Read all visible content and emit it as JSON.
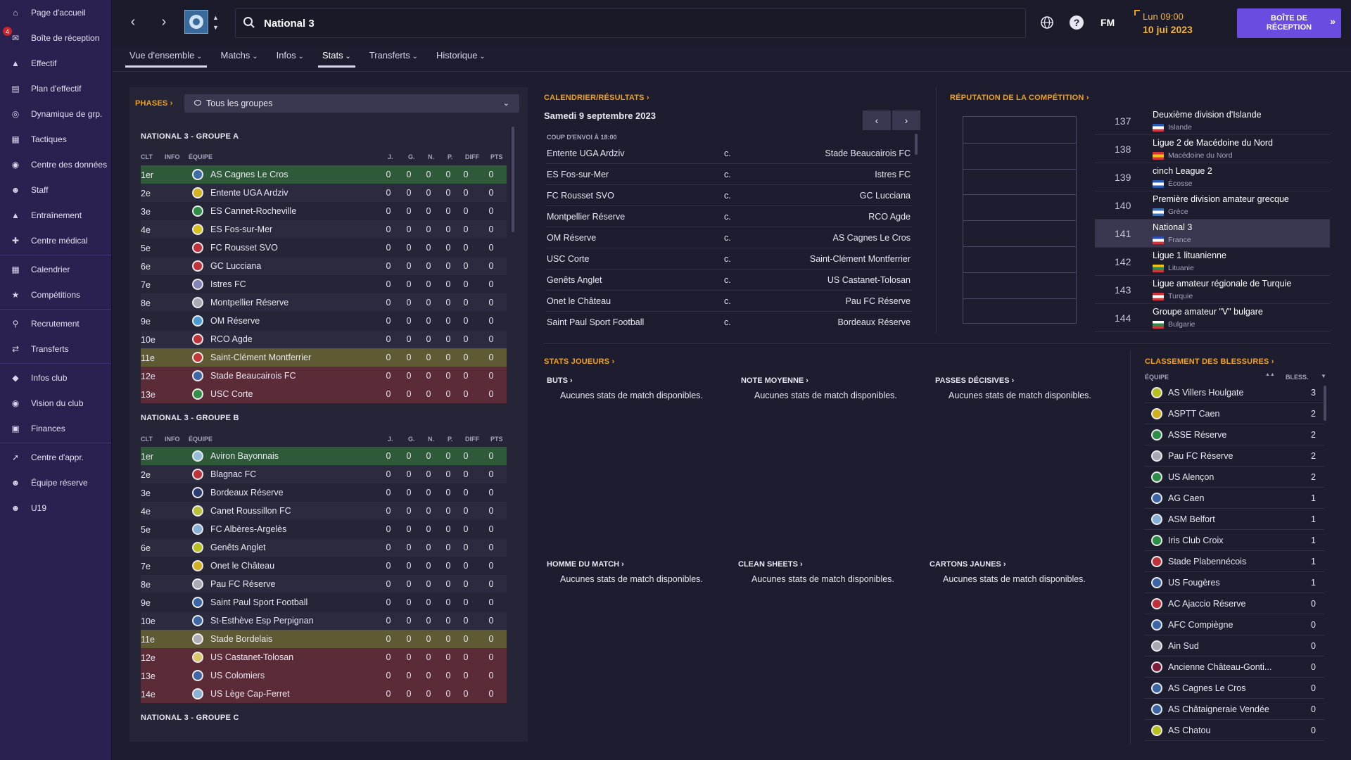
{
  "sidebar": {
    "items": [
      {
        "label": "Page d'accueil",
        "icon": "home-icon"
      },
      {
        "label": "Boîte de réception",
        "icon": "inbox-icon",
        "badge": "4"
      },
      {
        "label": "Effectif",
        "icon": "shirt-icon"
      },
      {
        "label": "Plan d'effectif",
        "icon": "clipboard-icon"
      },
      {
        "label": "Dynamique de grp.",
        "icon": "group-dynamics-icon"
      },
      {
        "label": "Tactiques",
        "icon": "tactics-board-icon"
      },
      {
        "label": "Centre des données",
        "icon": "data-hub-icon"
      },
      {
        "label": "Staff",
        "icon": "staff-icon"
      },
      {
        "label": "Entraînement",
        "icon": "training-cone-icon"
      },
      {
        "label": "Centre médical",
        "icon": "medical-kit-icon"
      },
      {
        "label": "Calendrier",
        "icon": "calendar-icon"
      },
      {
        "label": "Compétitions",
        "icon": "trophy-icon"
      },
      {
        "label": "Recrutement",
        "icon": "scout-search-icon"
      },
      {
        "label": "Transferts",
        "icon": "transfer-arrows-icon"
      },
      {
        "label": "Infos club",
        "icon": "club-shield-icon"
      },
      {
        "label": "Vision du club",
        "icon": "club-vision-icon"
      },
      {
        "label": "Finances",
        "icon": "money-icon"
      },
      {
        "label": "Centre d'appr.",
        "icon": "academy-shoe-icon"
      },
      {
        "label": "Équipe réserve",
        "icon": "reserve-team-icon"
      },
      {
        "label": "U19",
        "icon": "youth-team-icon"
      }
    ]
  },
  "topbar": {
    "search_text": "National 3",
    "date_time": "Lun 09:00",
    "date": "10 jui 2023",
    "inbox_button": "BOÎTE DE RÉCEPTION",
    "fm_label": "FM"
  },
  "tabs": [
    {
      "label": "Vue d'ensemble"
    },
    {
      "label": "Matchs"
    },
    {
      "label": "Infos"
    },
    {
      "label": "Stats"
    },
    {
      "label": "Transferts"
    },
    {
      "label": "Historique"
    }
  ],
  "phases": {
    "label": "PHASES",
    "dropdown": "Tous les groupes"
  },
  "table_headers": {
    "pos": "CLT",
    "info": "INFO",
    "team": "ÉQUIPE",
    "p": "J.",
    "w": "G.",
    "d": "N.",
    "l": "P.",
    "gd": "DIFF",
    "pts": "PTS"
  },
  "group_a": {
    "title": "NATIONAL 3 - GROUPE A",
    "rows": [
      {
        "pos": "1er",
        "team": "AS Cagnes Le Cros",
        "zone": "promo",
        "color": "#3f6fb3"
      },
      {
        "pos": "2e",
        "team": "Entente UGA Ardziv",
        "zone": "",
        "color": "#e4c21c"
      },
      {
        "pos": "3e",
        "team": "ES Cannet-Rocheville",
        "zone": "",
        "color": "#2e9a4a"
      },
      {
        "pos": "4e",
        "team": "ES Fos-sur-Mer",
        "zone": "",
        "color": "#e8d21a"
      },
      {
        "pos": "5e",
        "team": "FC Rousset SVO",
        "zone": "",
        "color": "#d0353b"
      },
      {
        "pos": "6e",
        "team": "GC Lucciana",
        "zone": "",
        "color": "#d0353b"
      },
      {
        "pos": "7e",
        "team": "Istres FC",
        "zone": "",
        "color": "#8a8fc4"
      },
      {
        "pos": "8e",
        "team": "Montpellier Réserve",
        "zone": "",
        "color": "#b8b8c4"
      },
      {
        "pos": "9e",
        "team": "OM Réserve",
        "zone": "",
        "color": "#4fa8e0"
      },
      {
        "pos": "10e",
        "team": "RCO Agde",
        "zone": "",
        "color": "#d0353b"
      },
      {
        "pos": "11e",
        "team": "Saint-Clément Montferrier",
        "zone": "play",
        "color": "#d0353b"
      },
      {
        "pos": "12e",
        "team": "Stade Beaucairois FC",
        "zone": "rel",
        "color": "#3f6fb3"
      },
      {
        "pos": "13e",
        "team": "USC Corte",
        "zone": "rel",
        "color": "#2e9a4a"
      }
    ]
  },
  "group_b": {
    "title": "NATIONAL 3 - GROUPE B",
    "rows": [
      {
        "pos": "1er",
        "team": "Aviron Bayonnais",
        "zone": "promo",
        "color": "#9ec7e8"
      },
      {
        "pos": "2e",
        "team": "Blagnac FC",
        "zone": "",
        "color": "#d0353b"
      },
      {
        "pos": "3e",
        "team": "Bordeaux Réserve",
        "zone": "",
        "color": "#2b3f7a"
      },
      {
        "pos": "4e",
        "team": "Canet Roussillon FC",
        "zone": "",
        "color": "#c8d23a"
      },
      {
        "pos": "5e",
        "team": "FC Albères-Argelès",
        "zone": "",
        "color": "#8ec0e6"
      },
      {
        "pos": "6e",
        "team": "Genêts Anglet",
        "zone": "",
        "color": "#c8d21a"
      },
      {
        "pos": "7e",
        "team": "Onet le Château",
        "zone": "",
        "color": "#e4c21c"
      },
      {
        "pos": "8e",
        "team": "Pau FC Réserve",
        "zone": "",
        "color": "#b8b8c4"
      },
      {
        "pos": "9e",
        "team": "Saint Paul Sport Football",
        "zone": "",
        "color": "#3f6fb3"
      },
      {
        "pos": "10e",
        "team": "St-Esthève Esp Perpignan",
        "zone": "",
        "color": "#3f6fb3"
      },
      {
        "pos": "11e",
        "team": "Stade Bordelais",
        "zone": "play",
        "color": "#b8b8c4"
      },
      {
        "pos": "12e",
        "team": "US Castanet-Tolosan",
        "zone": "rel",
        "color": "#e8d86a"
      },
      {
        "pos": "13e",
        "team": "US Colomiers",
        "zone": "rel",
        "color": "#3f6fb3"
      },
      {
        "pos": "14e",
        "team": "US Lège Cap-Ferret",
        "zone": "rel",
        "color": "#8ec0e6"
      }
    ]
  },
  "group_c": {
    "title": "NATIONAL 3 - GROUPE C"
  },
  "fixtures": {
    "title": "CALENDRIER/RÉSULTATS",
    "date": "Samedi 9 septembre 2023",
    "kickoff": "COUP D'ENVOI À 18:00",
    "versus": "c.",
    "rows": [
      {
        "home": "Entente UGA Ardziv",
        "away": "Stade Beaucairois FC"
      },
      {
        "home": "ES Fos-sur-Mer",
        "away": "Istres FC"
      },
      {
        "home": "FC Rousset SVO",
        "away": "GC Lucciana"
      },
      {
        "home": "Montpellier Réserve",
        "away": "RCO Agde"
      },
      {
        "home": "OM Réserve",
        "away": "AS Cagnes Le Cros"
      },
      {
        "home": "USC Corte",
        "away": "Saint-Clément Montferrier"
      },
      {
        "home": "Genêts Anglet",
        "away": "US Castanet-Tolosan"
      },
      {
        "home": "Onet le Château",
        "away": "Pau FC Réserve"
      },
      {
        "home": "Saint Paul Sport Football",
        "away": "Bordeaux Réserve"
      }
    ]
  },
  "reputation": {
    "title": "RÉPUTATION DE LA COMPÉTITION",
    "rows": [
      {
        "rank": "137",
        "name": "Deuxième division d'Islande",
        "country": "Islande",
        "flag": [
          "#2a5ab0",
          "#fff",
          "#d0353b"
        ]
      },
      {
        "rank": "138",
        "name": "Ligue 2 de Macédoine du Nord",
        "country": "Macédoine du Nord",
        "flag": [
          "#d0353b",
          "#f1c21a",
          "#d0353b"
        ]
      },
      {
        "rank": "139",
        "name": "cinch League 2",
        "country": "Écosse",
        "flag": [
          "#2a5ab0",
          "#fff",
          "#2a5ab0"
        ]
      },
      {
        "rank": "140",
        "name": "Première division amateur grecque",
        "country": "Grèce",
        "flag": [
          "#3f6fb3",
          "#fff",
          "#3f6fb3"
        ]
      },
      {
        "rank": "141",
        "name": "National 3",
        "country": "France",
        "flag": [
          "#2a4ab0",
          "#fff",
          "#d0353b"
        ],
        "selected": true
      },
      {
        "rank": "142",
        "name": "Ligue 1 lituanienne",
        "country": "Lituanie",
        "flag": [
          "#f1c21a",
          "#2e8a4a",
          "#d0353b"
        ]
      },
      {
        "rank": "143",
        "name": "Ligue amateur régionale de Turquie",
        "country": "Turquie",
        "flag": [
          "#d0353b",
          "#fff",
          "#d0353b"
        ]
      },
      {
        "rank": "144",
        "name": "Groupe amateur \"V\" bulgare",
        "country": "Bulgarie",
        "flag": [
          "#fff",
          "#2e8a4a",
          "#d0353b"
        ]
      }
    ]
  },
  "player_stats": {
    "title": "STATS JOUEURS",
    "empty_text": "Aucunes stats de match disponibles.",
    "categories": [
      {
        "label": "BUTS"
      },
      {
        "label": "NOTE MOYENNE"
      },
      {
        "label": "PASSES DÉCISIVES"
      },
      {
        "label": "HOMME DU MATCH"
      },
      {
        "label": "CLEAN SHEETS"
      },
      {
        "label": "CARTONS JAUNES"
      }
    ]
  },
  "injuries": {
    "title": "CLASSEMENT DES BLESSURES",
    "team_header": "ÉQUIPE",
    "count_header": "BLESS.",
    "rows": [
      {
        "team": "AS Villers Houlgate",
        "value": "3",
        "color": "#c8d21a"
      },
      {
        "team": "ASPTT Caen",
        "value": "2",
        "color": "#e4c21c"
      },
      {
        "team": "ASSE Réserve",
        "value": "2",
        "color": "#2e9a4a"
      },
      {
        "team": "Pau FC Réserve",
        "value": "2",
        "color": "#b8b8c4"
      },
      {
        "team": "US Alençon",
        "value": "2",
        "color": "#2e9a4a"
      },
      {
        "team": "AG Caen",
        "value": "1",
        "color": "#3f6fb3"
      },
      {
        "team": "ASM Belfort",
        "value": "1",
        "color": "#8ec0e6"
      },
      {
        "team": "Iris Club Croix",
        "value": "1",
        "color": "#2e9a4a"
      },
      {
        "team": "Stade Plabennécois",
        "value": "1",
        "color": "#d0353b"
      },
      {
        "team": "US Fougères",
        "value": "1",
        "color": "#3f6fb3"
      },
      {
        "team": "AC Ajaccio Réserve",
        "value": "0",
        "color": "#d0353b"
      },
      {
        "team": "AFC Compiègne",
        "value": "0",
        "color": "#3f6fb3"
      },
      {
        "team": "Ain Sud",
        "value": "0",
        "color": "#b8b8c4"
      },
      {
        "team": "Ancienne Château-Gonti...",
        "value": "0",
        "color": "#8a1a3a"
      },
      {
        "team": "AS Cagnes Le Cros",
        "value": "0",
        "color": "#3f6fb3"
      },
      {
        "team": "AS Châtaigneraie Vendée",
        "value": "0",
        "color": "#3f6fb3"
      },
      {
        "team": "AS Chatou",
        "value": "0",
        "color": "#c8d21a"
      }
    ]
  },
  "colors": {
    "accent": "#f1a21c",
    "sidebar": "#2a2150",
    "button": "#6a4ce0",
    "promo": "#2f5a3a",
    "playoff": "#5e5a34",
    "relegation": "#5b2c38"
  }
}
